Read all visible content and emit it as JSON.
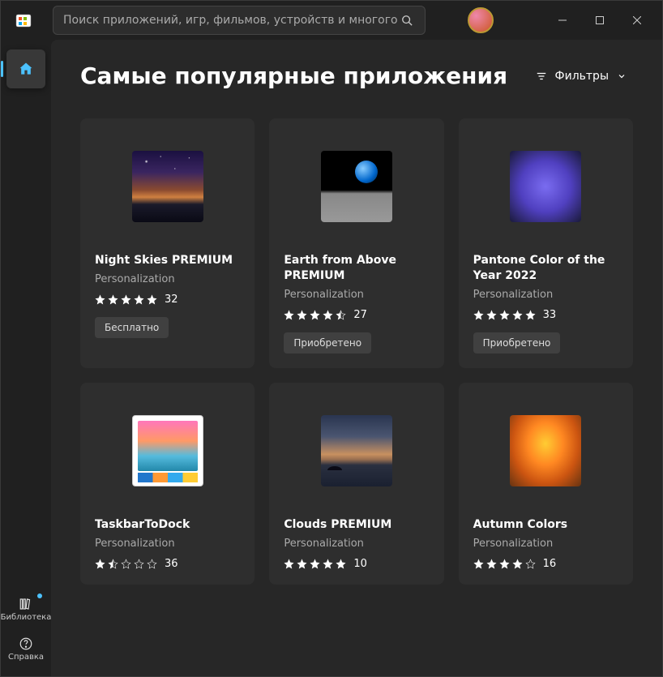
{
  "search": {
    "placeholder": "Поиск приложений, игр, фильмов, устройств и многого другого"
  },
  "sidebar": {
    "library_label": "Библиотека",
    "help_label": "Справка"
  },
  "header": {
    "title": "Самые популярные приложения",
    "filter_label": "Фильтры"
  },
  "badges": {
    "free": "Бесплатно",
    "owned": "Приобретено"
  },
  "apps": [
    {
      "title": "Night Skies PREMIUM",
      "category": "Personalization",
      "rating": 5,
      "count": "32",
      "badge": "free",
      "img": "night"
    },
    {
      "title": "Earth from Above PREMIUM",
      "category": "Personalization",
      "rating": 4.5,
      "count": "27",
      "badge": "owned",
      "img": "earth"
    },
    {
      "title": "Pantone Color of the Year 2022",
      "category": "Personalization",
      "rating": 5,
      "count": "33",
      "badge": "owned",
      "img": "pantone"
    },
    {
      "title": "TaskbarToDock",
      "category": "Personalization",
      "rating": 1.5,
      "count": "36",
      "badge": "",
      "img": "taskbar"
    },
    {
      "title": "Clouds PREMIUM",
      "category": "Personalization",
      "rating": 5,
      "count": "10",
      "badge": "",
      "img": "clouds"
    },
    {
      "title": "Autumn Colors",
      "category": "Personalization",
      "rating": 4,
      "count": "16",
      "badge": "",
      "img": "autumn"
    }
  ]
}
